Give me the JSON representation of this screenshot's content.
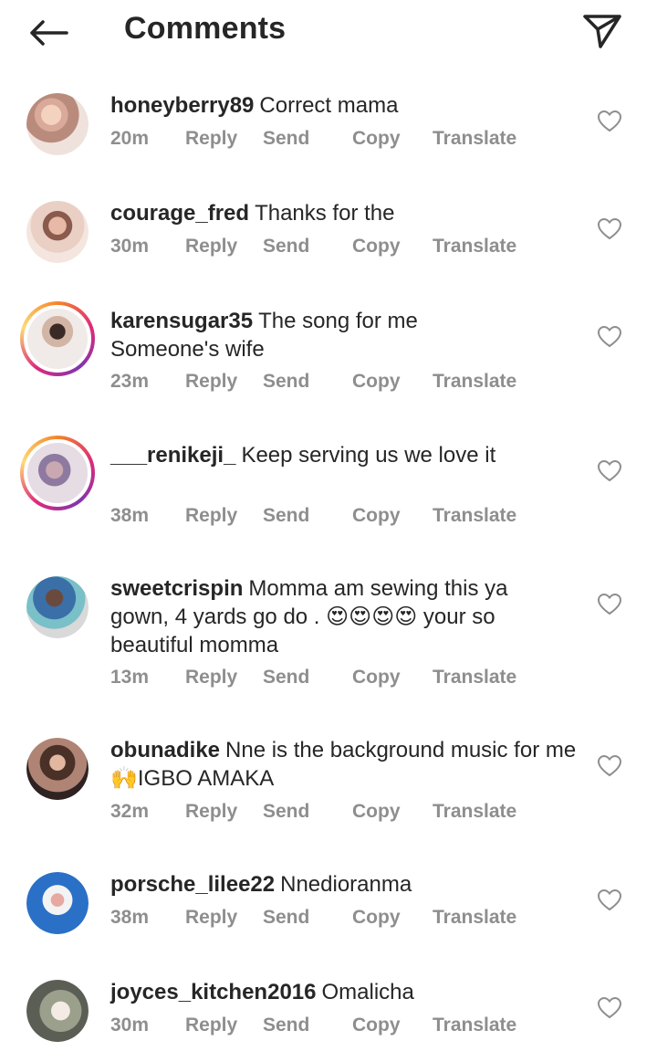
{
  "header": {
    "title": "Comments"
  },
  "actions": {
    "reply": "Reply",
    "send": "Send",
    "copy": "Copy",
    "translate": "Translate"
  },
  "comments": [
    {
      "username": "honeyberry89",
      "text": "Correct mama",
      "time": "20m"
    },
    {
      "username": "courage_fred",
      "text": "Thanks for the",
      "time": "30m"
    },
    {
      "username": "karensugar35",
      "text": "The song for me Someone's wife",
      "time": "23m"
    },
    {
      "username": "___renikeji_",
      "text": "Keep serving us we love it",
      "time": "38m"
    },
    {
      "username": "sweetcrispin",
      "text_before": "Momma am sewing this ya gown, 4 yards go do .",
      "emoji": "😍😍😍😍",
      "text_after": "your so beautiful momma",
      "time": "13m"
    },
    {
      "username": "obunadike",
      "text_before": "Nne is the background music for me",
      "emoji": "🙌",
      "text_after": "IGBO AMAKA",
      "time": "32m"
    },
    {
      "username": "porsche_lilee22",
      "text": "Nnedioranma",
      "time": "38m"
    },
    {
      "username": "joyces_kitchen2016",
      "text": "Omalicha",
      "time": "30m"
    }
  ]
}
